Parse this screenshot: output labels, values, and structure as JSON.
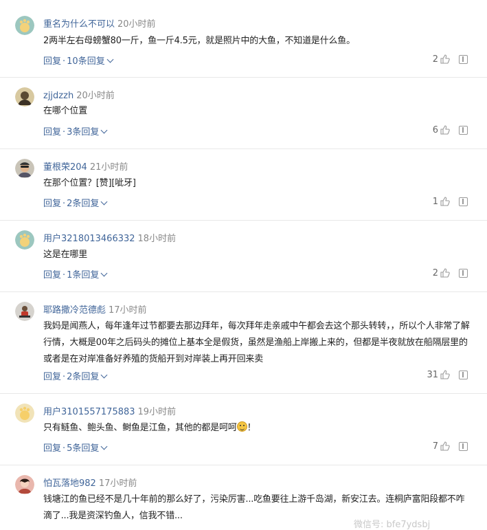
{
  "comments": [
    {
      "username": "重名为什么不可以",
      "time": "20小时前",
      "text": "2两半左右母螃蟹80一斤，鱼一斤4.5元，就是照片中的大鱼，不知道是什么鱼。",
      "reply_label": "回复",
      "reply_count": "10条回复",
      "likes": "2",
      "avatar": "default-cartoon-avatar"
    },
    {
      "username": "zjjdzzh",
      "time": "20小时前",
      "text": "在哪个位置",
      "reply_label": "回复",
      "reply_count": "3条回复",
      "likes": "6",
      "avatar": "photo-avatar"
    },
    {
      "username": "董根荣204",
      "time": "21小时前",
      "text": "在那个位置？[赞][呲牙]",
      "reply_label": "回复",
      "reply_count": "2条回复",
      "likes": "1",
      "avatar": "photo-avatar"
    },
    {
      "username": "用户3218013466332",
      "time": "18小时前",
      "text": "这是在哪里",
      "reply_label": "回复",
      "reply_count": "1条回复",
      "likes": "2",
      "avatar": "default-cartoon-avatar"
    },
    {
      "username": "耶路撒冷范德彪",
      "time": "17小时前",
      "text": "我妈是闻燕人，每年逢年过节都要去那边拜年，每次拜年走亲戚中午都会去这个那头转转，，所以个人非常了解行情，大概是00年之后码头的摊位上基本全是假货，虽然是渔船上岸搬上来的，但都是半夜就放在船隔层里的 或者是在对岸准备好养殖的货船开到对岸装上再开回来卖",
      "reply_label": "回复",
      "reply_count": "2条回复",
      "likes": "31",
      "avatar": "photo-avatar"
    },
    {
      "username": "用户3101557175883",
      "time": "19小时前",
      "text": "只有鲢鱼、鲍头鱼、鲥鱼是江鱼，其他的都是呵呵",
      "text_suffix": "！",
      "reply_label": "回复",
      "reply_count": "5条回复",
      "likes": "7",
      "avatar": "default-cartoon-avatar"
    },
    {
      "username": "怕瓦落地982",
      "time": "17小时前",
      "text": "钱塘江的鱼已经不是几十年前的那么好了，污染厉害...吃鱼要往上游千岛湖，新安江去。连桐庐富阳段都不咋滴了...我是资深钓鱼人，信我不错...",
      "avatar": "photo-avatar"
    }
  ],
  "separator": "·",
  "watermark": "微信号: bfe7ydsbj"
}
